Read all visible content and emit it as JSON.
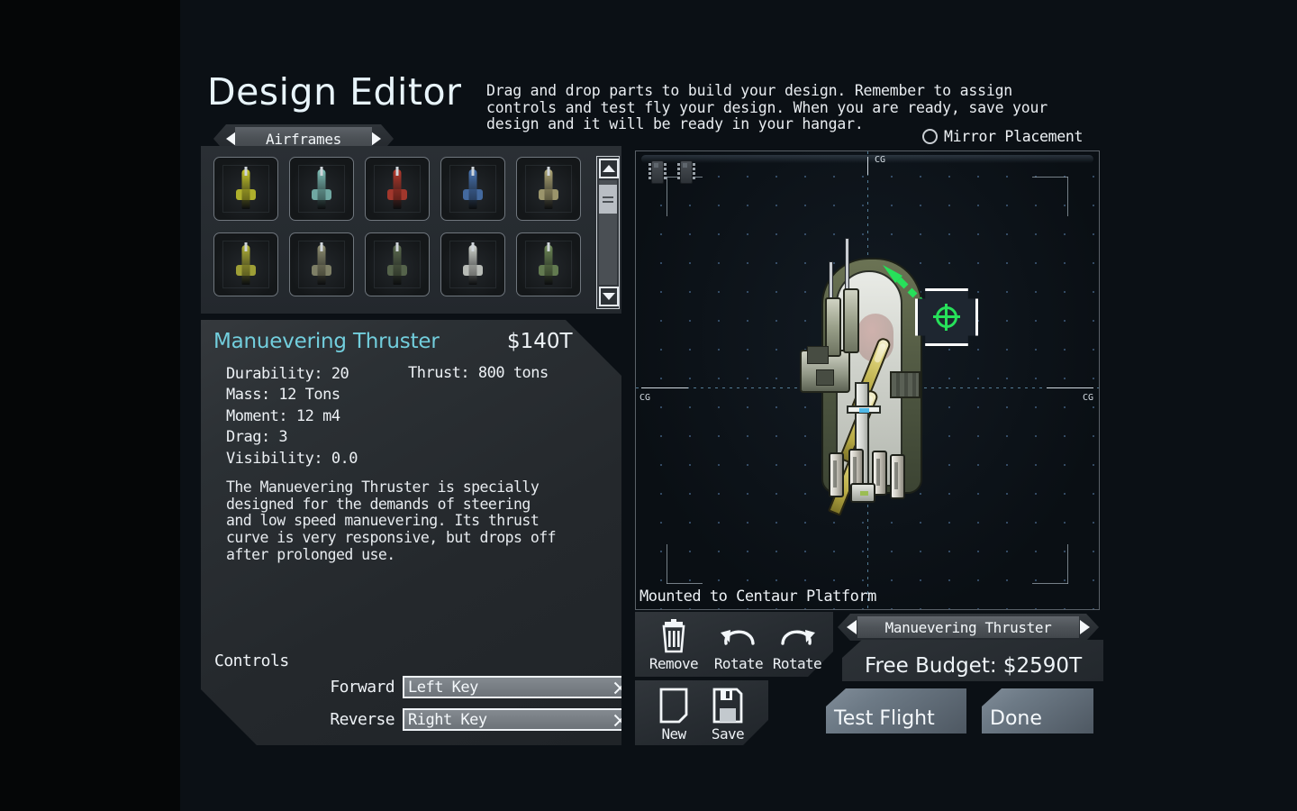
{
  "header": {
    "title": "Design Editor",
    "instructions": [
      "Drag and drop parts to build your design. Remember to assign",
      "controls and test fly your design. When you are ready, save your",
      "design and it will be ready in your hangar."
    ],
    "mirror_placement_label": "Mirror Placement",
    "mirror_placement_checked": false
  },
  "palette": {
    "category_tab": "Airframes",
    "prev_icon": "triangle-left-icon",
    "next_icon": "triangle-right-icon",
    "scrollbar": {
      "up_icon": "triangle-up-icon",
      "down_icon": "triangle-down-icon",
      "thumb_position_percent": 6
    },
    "slots": [
      {
        "name": "airframe-1",
        "accent": "#c8c82e"
      },
      {
        "name": "airframe-2",
        "accent": "#7fbfb8"
      },
      {
        "name": "airframe-3",
        "accent": "#b83b2e"
      },
      {
        "name": "airframe-4",
        "accent": "#4a76b4"
      },
      {
        "name": "airframe-5",
        "accent": "#b0a878"
      },
      {
        "name": "airframe-6",
        "accent": "#b4b43a"
      },
      {
        "name": "airframe-7",
        "accent": "#8f8f72"
      },
      {
        "name": "airframe-8",
        "accent": "#5f6e52"
      },
      {
        "name": "airframe-9",
        "accent": "#d2d6d0"
      },
      {
        "name": "airframe-10",
        "accent": "#6f8a58"
      }
    ]
  },
  "part_info": {
    "name": "Manuevering Thruster",
    "price": "$140T",
    "stats_left": [
      "Durability: 20",
      "Mass: 12 Tons",
      "Moment: 12 m4",
      "Drag: 3",
      "Visibility: 0.0"
    ],
    "stat_thrust": "Thrust: 800 tons",
    "description": [
      "The Manuevering Thruster is specially",
      "designed for the demands of steering",
      "and low speed manuevering. Its thrust",
      "curve is very responsive, but drops off",
      "after prolonged use."
    ],
    "controls_title": "Controls",
    "controls": [
      {
        "label": "Forward",
        "value": "Left Key",
        "clear_icon": "close-x-icon"
      },
      {
        "label": "Reverse",
        "value": "Right Key",
        "clear_icon": "close-x-icon"
      }
    ]
  },
  "canvas": {
    "cg_top_label": "CG",
    "cg_left_label": "CG",
    "cg_right_label": "CG",
    "mounted_label": "Mounted to Centaur Platform",
    "selected_part_icon": "crosshair-icon",
    "thrust_vector_icon": "thrust-arrow-icon",
    "chip_icon": "ic-chip-icon"
  },
  "toolbar": {
    "remove_label": "Remove",
    "remove_icon": "trash-icon",
    "rotate_ccw_label": "Rotate",
    "rotate_ccw_icon": "rotate-ccw-icon",
    "rotate_cw_label": "Rotate",
    "rotate_cw_icon": "rotate-cw-icon",
    "new_label": "New",
    "new_icon": "new-document-icon",
    "save_label": "Save",
    "save_icon": "floppy-disk-icon"
  },
  "footer": {
    "selected_part": "Manuevering Thruster",
    "prev_icon": "triangle-left-icon",
    "next_icon": "triangle-right-icon",
    "budget_label": "Free Budget: $2590T",
    "test_flight_label": "Test Flight",
    "done_label": "Done"
  },
  "colors": {
    "panel_bg": "#0b1015",
    "accent_cyan": "#72cedd",
    "text": "#eef2f6",
    "thrust_green": "#27e05a"
  }
}
